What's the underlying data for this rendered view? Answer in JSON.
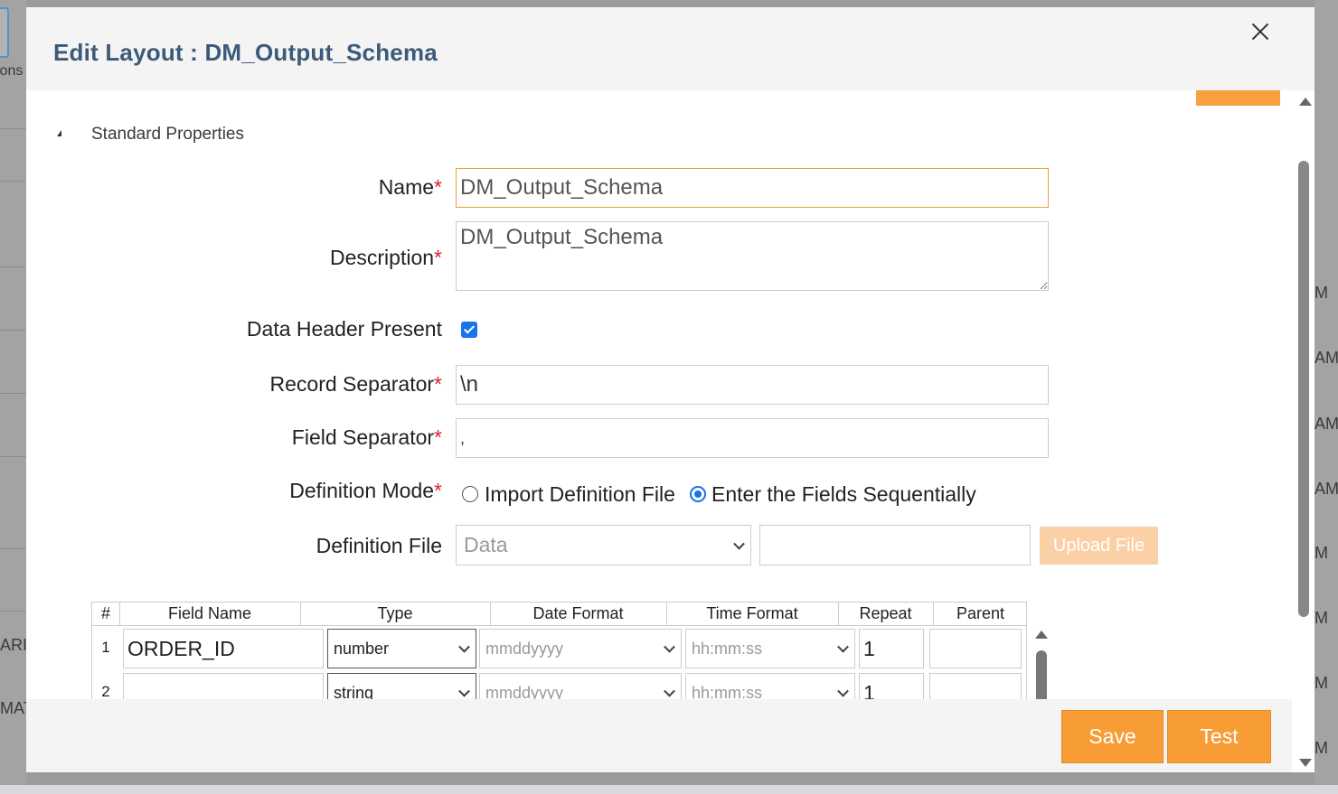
{
  "background": {
    "left_fragments": [
      "ions",
      "ARI",
      "MAT"
    ],
    "right_fragments": [
      "M",
      "AM",
      "AM",
      "AM",
      "M",
      "M",
      "M",
      "M"
    ]
  },
  "modal": {
    "title": "Edit Layout : DM_Output_Schema",
    "close_label": "×"
  },
  "section": {
    "title": "Standard Properties"
  },
  "form": {
    "name_label": "Name",
    "name_value": "DM_Output_Schema",
    "description_label": "Description",
    "description_value": "DM_Output_Schema",
    "data_header_label": "Data Header Present",
    "data_header_checked": true,
    "record_sep_label": "Record Separator",
    "record_sep_value": "\\n",
    "field_sep_label": "Field Separator",
    "field_sep_value": ",",
    "def_mode_label": "Definition Mode",
    "def_mode_opt1": "Import Definition File",
    "def_mode_opt2": "Enter the Fields Sequentially",
    "def_mode_selected": "Enter the Fields Sequentially",
    "def_file_label": "Definition File",
    "def_file_select": "Data",
    "def_file_path": "",
    "upload_label": "Upload File",
    "required_mark": "*"
  },
  "grid": {
    "headers": [
      "#",
      "Field Name",
      "Type",
      "Date Format",
      "Time Format",
      "Repeat",
      "Parent"
    ],
    "rows": [
      {
        "num": "1",
        "field_name": "ORDER_ID",
        "type": "number",
        "date_format": "mmddyyyy",
        "time_format": "hh:mm:ss",
        "repeat": "1",
        "parent": ""
      },
      {
        "num": "2",
        "field_name": "",
        "type": "string",
        "date_format": "mmddyyyy",
        "time_format": "hh:mm:ss",
        "repeat": "1",
        "parent": ""
      }
    ]
  },
  "footer": {
    "save_label": "Save",
    "test_label": "Test"
  },
  "colors": {
    "accent": "#f89c35",
    "title": "#3d5a78",
    "required": "#d9232d",
    "checkbox": "#1a73e8"
  }
}
